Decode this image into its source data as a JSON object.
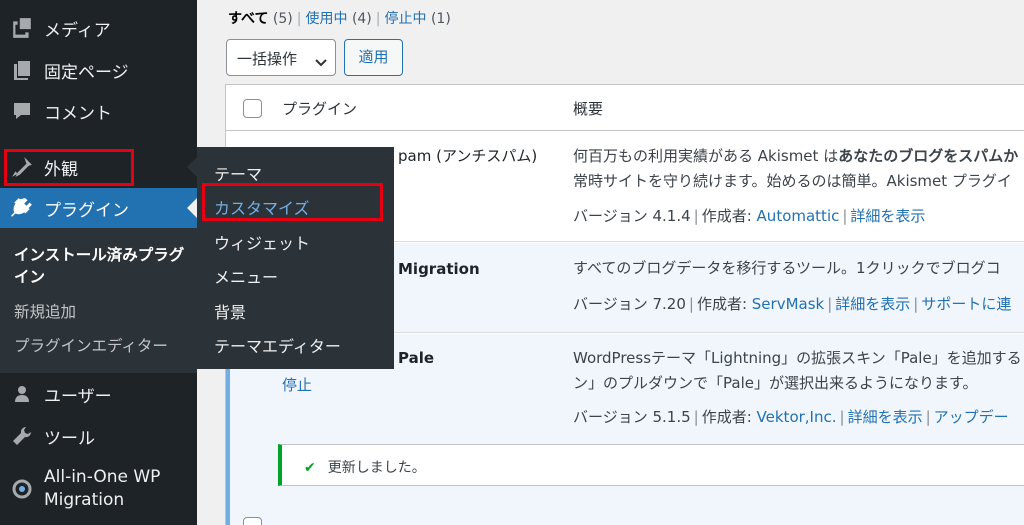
{
  "sidebar": {
    "media": "メディア",
    "pages": "固定ページ",
    "comments": "コメント",
    "appearance": "外観",
    "plugins": "プラグイン",
    "plugins_sub": [
      "インストール済みプラグイン",
      "新規追加",
      "プラグインエディター"
    ],
    "users": "ユーザー",
    "tools": "ツール",
    "aio": "All-in-One WP Migration"
  },
  "flyout": [
    "テーマ",
    "カスタマイズ",
    "ウィジェット",
    "メニュー",
    "背景",
    "テーマエディター"
  ],
  "filters": {
    "all": "すべて",
    "all_count": "(5)",
    "active": "使用中",
    "active_count": "(4)",
    "inactive": "停止中",
    "inactive_count": "(1)"
  },
  "bulk": {
    "label": "一括操作",
    "apply": "適用"
  },
  "table": {
    "col_plugin": "プラグイン",
    "col_desc": "概要",
    "rows": [
      {
        "name": "pam (アンチスパム)",
        "desc_1_plain": "何百万もの利用実績がある Akismet は",
        "desc_1_bold": "あなたのブログをスパムか",
        "desc_2": "常時サイトを守り続けます。始めるのは簡単。Akismet プラグイ",
        "version": "バージョン 4.1.4",
        "author_label": "作成者:",
        "author": "Automattic",
        "details": "詳細を表示"
      },
      {
        "name": "Migration",
        "desc_1": "すべてのブログデータを移行するツール。1クリックでブログコ",
        "version": "バージョン 7.20",
        "author_label": "作成者:",
        "author": "ServMask",
        "details": "詳細を表示",
        "support": "サポートに連"
      },
      {
        "name": "Pale",
        "action": "停止",
        "desc_1": "WordPressテーマ「Lightning」の拡張スキン「Pale」を追加する",
        "desc_2": "ン」のプルダウンで「Pale」が選択出来るようになります。",
        "version": "バージョン 5.1.5",
        "author_label": "作成者:",
        "author": "Vektor,Inc.",
        "details": "詳細を表示",
        "update": "アップデー"
      }
    ],
    "notice": "更新しました。"
  },
  "colors": {
    "highlight": "#e60012",
    "accent": "#2271b1",
    "sidebar": "#1d2327"
  }
}
